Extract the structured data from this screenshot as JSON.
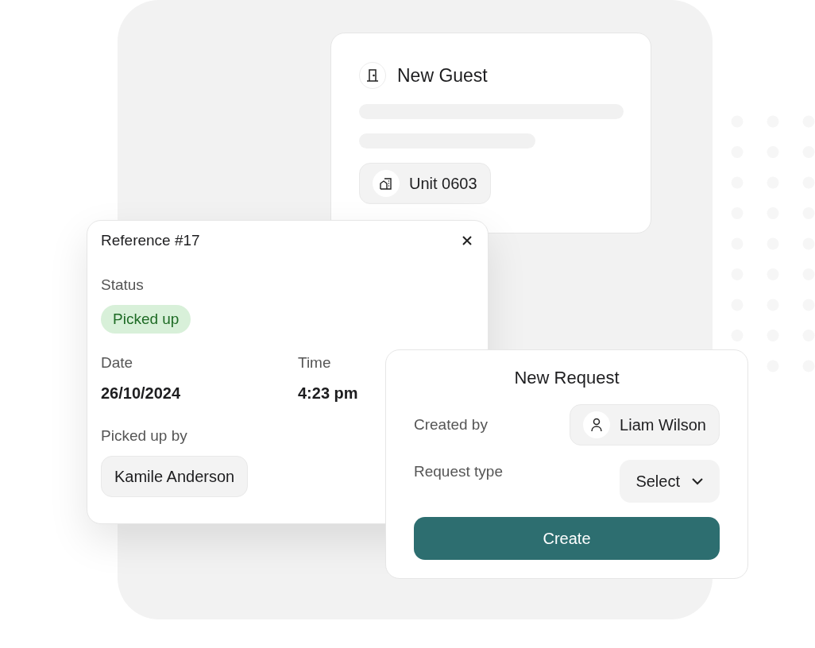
{
  "guest_card": {
    "title": "New Guest",
    "unit": "Unit 0603"
  },
  "reference_card": {
    "title": "Reference #17",
    "status": {
      "label": "Status",
      "value": "Picked up"
    },
    "date": {
      "label": "Date",
      "value": "26/10/2024"
    },
    "time": {
      "label": "Time",
      "value": "4:23 pm"
    },
    "picked_up_by": {
      "label": "Picked up by",
      "value": "Kamile Anderson"
    }
  },
  "request_card": {
    "title": "New Request",
    "created_by": {
      "label": "Created by",
      "value": "Liam Wilson"
    },
    "request_type": {
      "label": "Request type",
      "placeholder": "Select"
    },
    "button": "Create"
  }
}
